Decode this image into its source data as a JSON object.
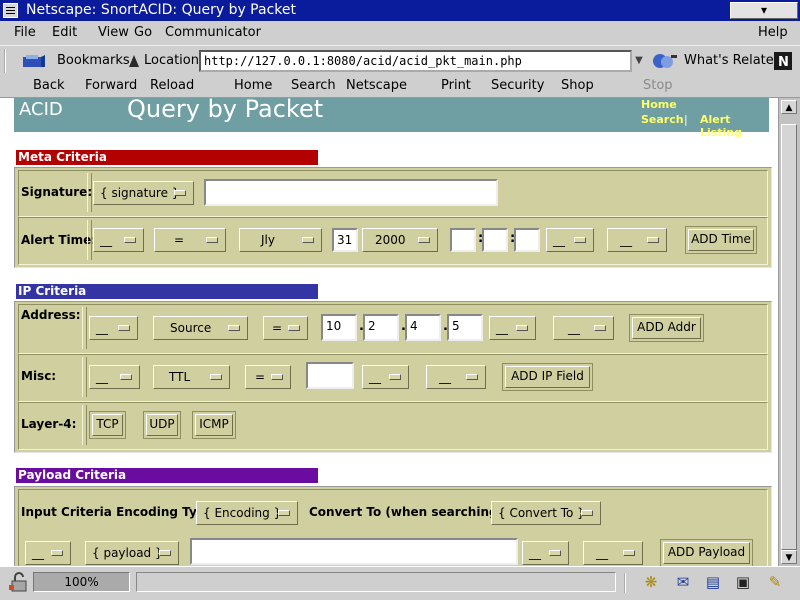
{
  "window": {
    "title": "Netscape: SnortACID: Query by Packet",
    "button_icon": "down-arrow"
  },
  "menu": [
    "File",
    "Edit",
    "View",
    "Go",
    "Communicator",
    "Help"
  ],
  "location": {
    "bookmarks_label": "Bookmarks",
    "location_label": "Location:",
    "url": "http://127.0.0.1:8080/acid/acid_pkt_main.php",
    "whats_related": "What's Related"
  },
  "nav": [
    "Back",
    "Forward",
    "Reload",
    "Home",
    "Search",
    "Netscape",
    "Print",
    "Security",
    "Shop",
    "Stop"
  ],
  "header": {
    "brand": "ACID",
    "title": "Query by Packet",
    "links": {
      "home": "Home",
      "search": "Search",
      "sep": "|",
      "alert_listing": "Alert Listing"
    }
  },
  "meta": {
    "heading": "Meta Criteria",
    "signature_label": "Signature:",
    "signature_select": "{ signature }",
    "signature_value": "",
    "alert_time_label": "Alert Time:",
    "time_open": "__",
    "time_op": "=",
    "month": "Jly",
    "day": "31",
    "year": "2000",
    "hour": "",
    "minute": "",
    "second": "",
    "close_paren": "__",
    "boolean": "__",
    "add_time": "ADD Time"
  },
  "ip": {
    "heading": "IP Criteria",
    "address_label": "Address:",
    "addr_open": "__",
    "addr_field": "Source",
    "addr_op": "=",
    "octets": [
      "10",
      "2",
      "4",
      "5"
    ],
    "addr_close": "__",
    "addr_bool": "__",
    "add_addr": "ADD Addr",
    "misc_label": "Misc:",
    "misc_open": "__",
    "misc_field": "TTL",
    "misc_op": "=",
    "misc_value": "",
    "misc_close": "__",
    "misc_bool": "__",
    "add_ip_field": "ADD IP Field",
    "layer4_label": "Layer-4:",
    "layer4_buttons": [
      "TCP",
      "UDP",
      "ICMP"
    ]
  },
  "payload": {
    "heading": "Payload Criteria",
    "encoding_label": "Input Criteria Encoding Type:",
    "encoding_select": "{ Encoding }",
    "convert_label": "Convert To (when searching):",
    "convert_select": "{ Convert To }",
    "open": "__",
    "field": "{ payload }",
    "value": "",
    "close": "__",
    "bool": "__",
    "add_payload": "ADD Payload"
  },
  "status": {
    "zoom": "100%"
  },
  "colors": {
    "meta": "#b30000",
    "ip": "#3434a4",
    "payload": "#6b0ca0",
    "form_bg": "#d0cfa0",
    "header_bg": "#6f9fa3"
  }
}
